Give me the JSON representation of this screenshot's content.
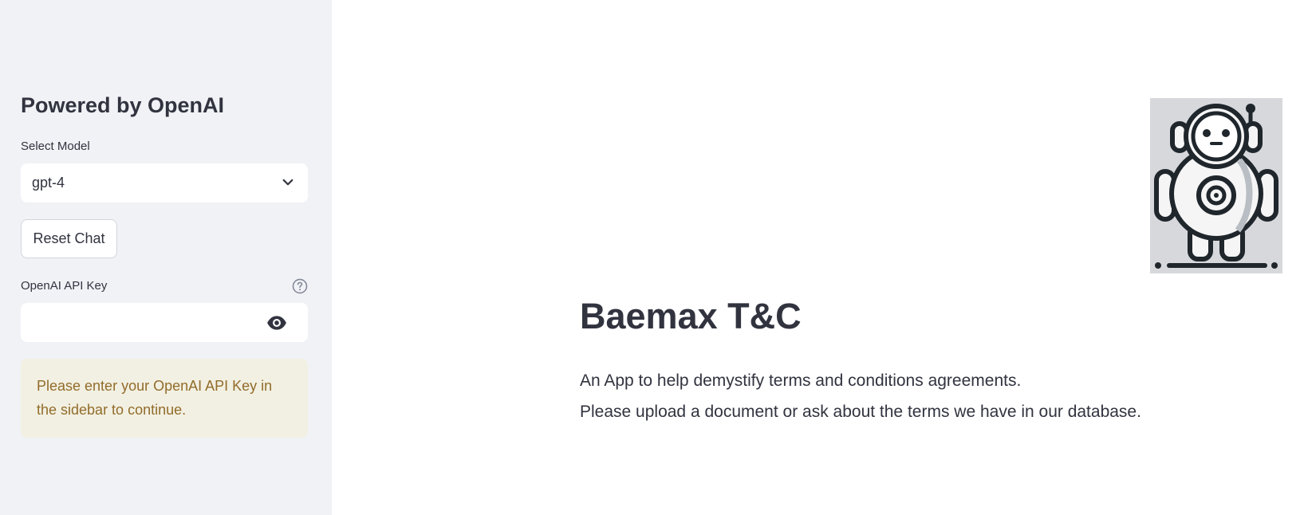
{
  "sidebar": {
    "heading": "Powered by OpenAI",
    "model_select": {
      "label": "Select Model",
      "value": "gpt-4"
    },
    "reset_button_label": "Reset Chat",
    "api_key": {
      "label": "OpenAI API Key",
      "value": "",
      "help_icon": "question-circle-icon",
      "visibility_icon": "eye-icon"
    },
    "warning_text": "Please enter your OpenAI API Key in the sidebar to continue."
  },
  "main": {
    "logo_icon": "robot-icon",
    "title": "Baemax T&C",
    "description_lines": [
      "An App to help demystify terms and conditions agreements.",
      "Please upload a document or ask about the terms we have in our database."
    ]
  },
  "colors": {
    "sidebar_bg": "#f0f2f6",
    "text": "#31333f",
    "warning_bg": "#f2f0e2",
    "warning_text": "#926c2b"
  }
}
